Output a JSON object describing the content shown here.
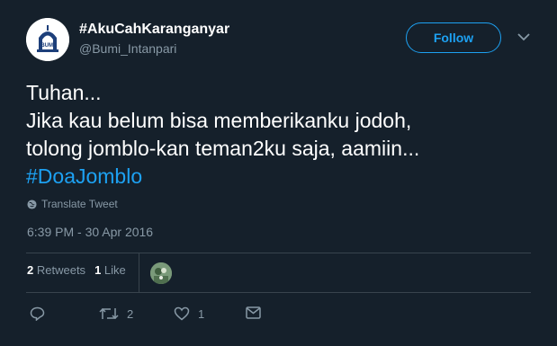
{
  "user": {
    "display_name": "#AkuCahKaranganyar",
    "handle": "@Bumi_Intanpari",
    "avatar_text": "BUMI"
  },
  "follow_label": "Follow",
  "tweet": {
    "text": "Tuhan...\nJika kau belum bisa memberikanku jodoh,\ntolong jomblo-kan teman2ku saja, aamiin...",
    "hashtag": "#DoaJomblo",
    "translate_label": "Translate Tweet",
    "timestamp": "6:39 PM - 30 Apr 2016"
  },
  "stats": {
    "retweets_count": "2",
    "retweets_label": "Retweets",
    "likes_count": "1",
    "likes_label": "Like"
  },
  "actions": {
    "retweet_count": "2",
    "like_count": "1"
  },
  "colors": {
    "background": "#15202b",
    "accent": "#1da1f2",
    "muted": "#8899a6",
    "divider": "#38444d"
  }
}
